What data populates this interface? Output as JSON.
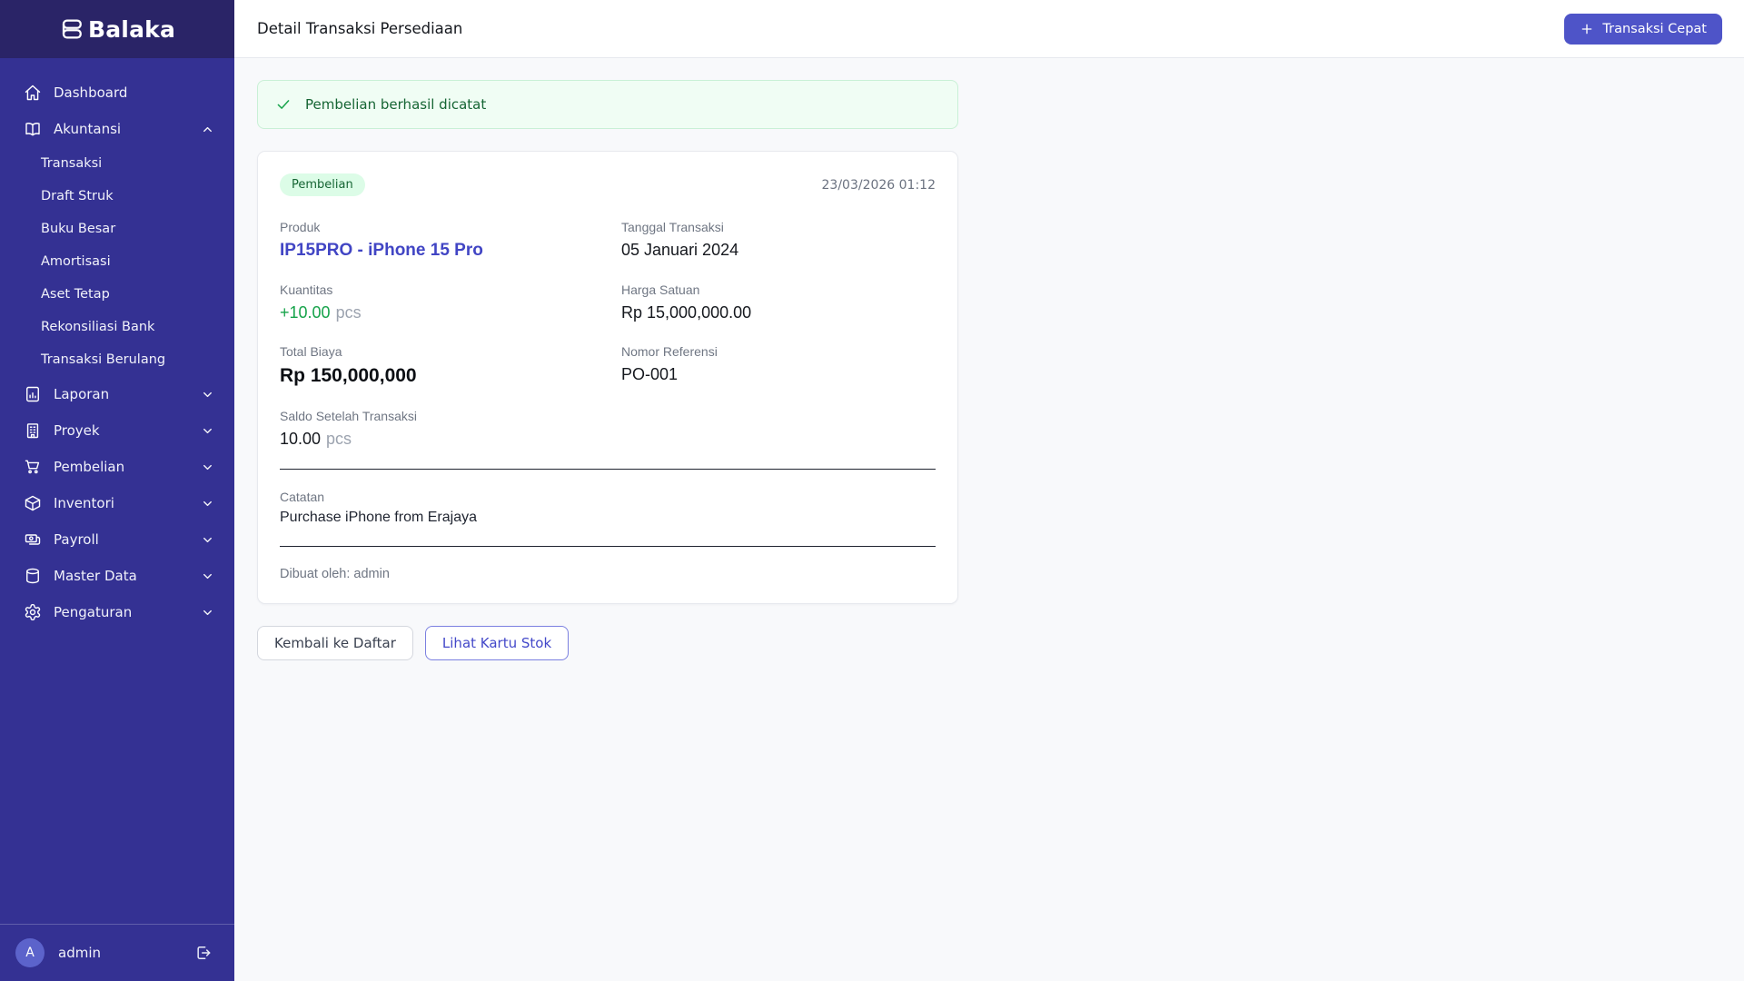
{
  "brand": {
    "name": "Balaka"
  },
  "sidebar": {
    "items": [
      {
        "label": "Dashboard",
        "icon": "home-icon"
      },
      {
        "label": "Akuntansi",
        "icon": "book-open-icon",
        "expanded": true,
        "children": [
          "Transaksi",
          "Draft Struk",
          "Buku Besar",
          "Amortisasi",
          "Aset Tetap",
          "Rekonsiliasi Bank",
          "Transaksi Berulang"
        ]
      },
      {
        "label": "Laporan",
        "icon": "chart-document-icon"
      },
      {
        "label": "Proyek",
        "icon": "building-icon"
      },
      {
        "label": "Pembelian",
        "icon": "shopping-cart-icon"
      },
      {
        "label": "Inventori",
        "icon": "cube-icon"
      },
      {
        "label": "Payroll",
        "icon": "banknotes-icon"
      },
      {
        "label": "Master Data",
        "icon": "database-icon"
      },
      {
        "label": "Pengaturan",
        "icon": "gear-icon"
      }
    ],
    "footer": {
      "avatar_initial": "A",
      "username": "admin"
    }
  },
  "header": {
    "title": "Detail Transaksi Persediaan",
    "quick_button_label": "Transaksi Cepat"
  },
  "alert": {
    "message": "Pembelian berhasil dicatat"
  },
  "card": {
    "badge": "Pembelian",
    "timestamp": "23/03/2026 01:12",
    "fields": [
      {
        "label": "Produk",
        "value": "IP15PRO - iPhone 15 Pro"
      },
      {
        "label": "Tanggal Transaksi",
        "value": "05 Januari 2024"
      },
      {
        "label": "Kuantitas",
        "value": "+10.00",
        "suffix": "pcs"
      },
      {
        "label": "Harga Satuan",
        "value": "Rp 15,000,000.00"
      },
      {
        "label": "Total Biaya",
        "value": "Rp 150,000,000"
      },
      {
        "label": "Nomor Referensi",
        "value": "PO-001"
      },
      {
        "label": "Saldo Setelah Transaksi",
        "value": "10.00",
        "suffix": "pcs"
      }
    ],
    "note_label": "Catatan",
    "note_value": "Purchase iPhone from Erajaya",
    "created_by": "Dibuat oleh: admin"
  },
  "actions": {
    "back_label": "Kembali ke Daftar",
    "stock_card_label": "Lihat Kartu Stok"
  },
  "colors": {
    "sidebar_bg": "#343193",
    "sidebar_header_bg": "#2a2467",
    "primary_button": "#4e54c8",
    "product_link": "#4145c4",
    "quantity_green": "#16a34a",
    "badge_bg": "#dcfce7",
    "badge_text": "#166534",
    "alert_bg": "#f0fdf4"
  }
}
